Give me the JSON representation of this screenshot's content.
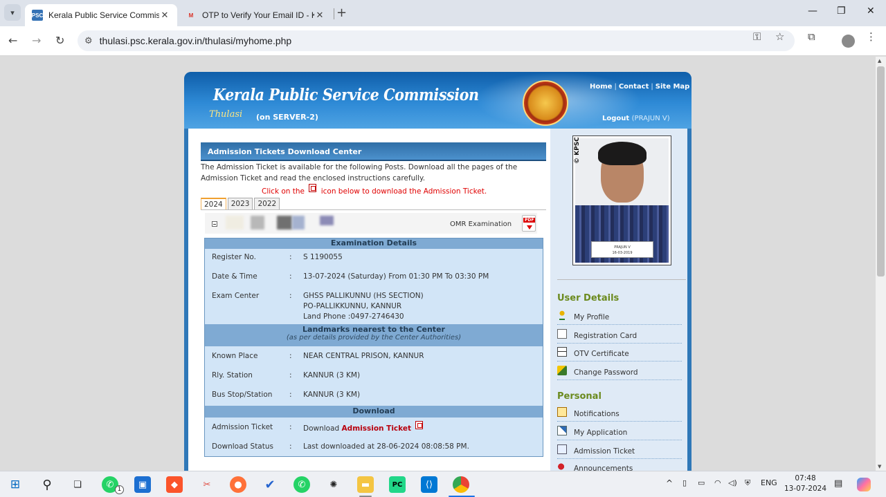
{
  "browser": {
    "tabs": [
      {
        "title": "Kerala Public Service Commissi",
        "active": true,
        "favicon": "psc-favicon"
      },
      {
        "title": "OTP to Verify Your Email ID - Ke",
        "active": false,
        "favicon": "gmail-icon"
      }
    ],
    "url": "thulasi.psc.kerala.gov.in/thulasi/myhome.php"
  },
  "site": {
    "title": "Kerala Public Service Commission",
    "brand": "Thulasi",
    "server": "(on SERVER-2)",
    "links": [
      "Home",
      "Contact",
      "Site Map"
    ],
    "logout_label": "Logout",
    "logout_user": "(PRAJUN V)"
  },
  "admission": {
    "heading": "Admission Tickets Download Center",
    "intro": "The Admission Ticket is available for the following Posts. Download all the pages of the Admission Ticket and read the enclosed instructions carefully.",
    "click_prefix": "Click on the",
    "click_suffix": "icon below to download the Admission Ticket.",
    "years": [
      "2024",
      "2023",
      "2022"
    ],
    "exam_type": "OMR Examination"
  },
  "exam_details": {
    "heading": "Examination Details",
    "register_label": "Register No.",
    "register_value": "S 1190055",
    "datetime_label": "Date & Time",
    "datetime_value": "13-07-2024 (Saturday) From 01:30 PM To 03:30 PM",
    "center_label": "Exam Center",
    "center_lines": [
      "GHSS PALLIKUNNU (HS SECTION)",
      "PO-PALLIKKUNNU, KANNUR",
      "Land Phone :0497-2746430"
    ],
    "landmarks_heading": "Landmarks nearest to the Center",
    "landmarks_sub": "(as per details provided by the Center Authorities)",
    "known_label": "Known Place",
    "known_value": "NEAR CENTRAL PRISON, KANNUR",
    "rly_label": "Rly. Station",
    "rly_value": "KANNUR (3 KM)",
    "bus_label": "Bus Stop/Station",
    "bus_value": "KANNUR (3 KM)",
    "download_heading": "Download",
    "ticket_label": "Admission Ticket",
    "ticket_prefix": "Download",
    "ticket_link": "Admission Ticket",
    "status_label": "Download Status",
    "status_value": "Last downloaded at 28-06-2024 08:08:58 PM.",
    "colon": ":"
  },
  "photo": {
    "watermark": "© KPSC",
    "name": "PRAJUN V",
    "date": "16-03-2019"
  },
  "user_details": {
    "heading": "User Details",
    "items": [
      "My Profile",
      "Registration Card",
      "OTV Certificate",
      "Change Password"
    ]
  },
  "personal": {
    "heading": "Personal",
    "items": [
      "Notifications",
      "My Application",
      "Admission Ticket",
      "Announcements"
    ]
  },
  "taskbar": {
    "language": "ENG",
    "time": "07:48",
    "date": "13-07-2024",
    "whatsapp_badge": "1"
  }
}
